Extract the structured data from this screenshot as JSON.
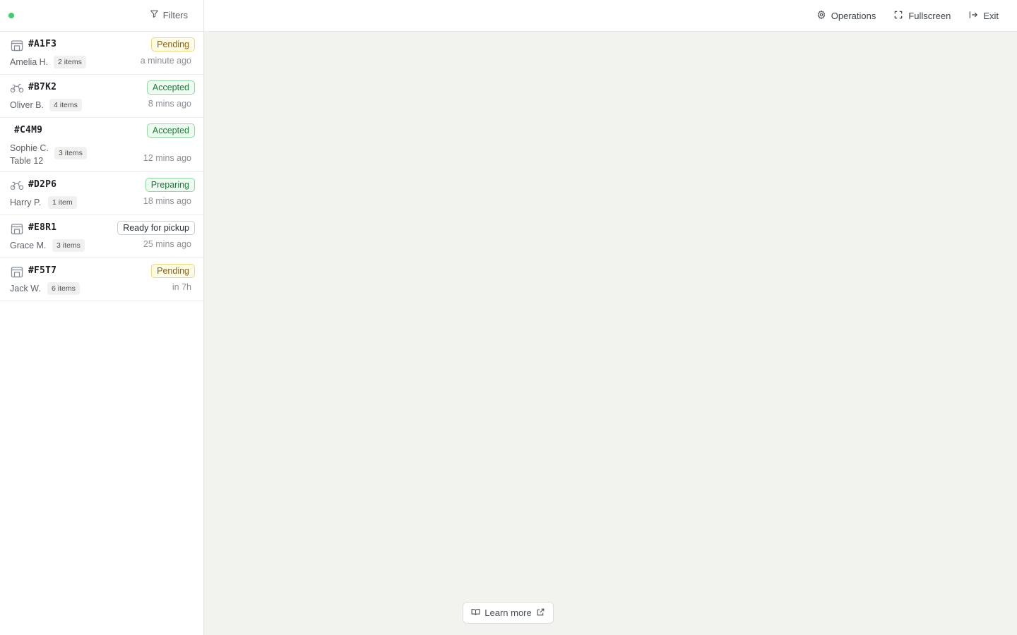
{
  "colors": {
    "live": "#3ecf6a",
    "pending": "#f1d97a",
    "accepted": "#8fd9a0",
    "ready": "#c9ccd1"
  },
  "sidebar": {
    "live_indicator": "live-status-dot",
    "filters_icon": "filter-icon",
    "filters_label": "Filters"
  },
  "orders": [
    {
      "type_icon": "store-icon",
      "code": "#A1F3",
      "status": "Pending",
      "customer": "Amelia H.",
      "items": "2 items",
      "time": "a minute ago"
    },
    {
      "type_icon": "delivery-icon",
      "code": "#B7K2",
      "status": "Accepted",
      "customer": "Oliver B.",
      "items": "4 items",
      "time": "8 mins ago"
    },
    {
      "type_icon": "",
      "code": "#C4M9",
      "status": "Accepted",
      "customer": "Sophie C.",
      "table": "Table 12",
      "items": "3 items",
      "time": "12 mins ago"
    },
    {
      "type_icon": "delivery-icon",
      "code": "#D2P6",
      "status": "Preparing",
      "customer": "Harry P.",
      "items": "1 item",
      "time": "18 mins ago"
    },
    {
      "type_icon": "store-icon",
      "code": "#E8R1",
      "status": "Ready for pickup",
      "customer": "Grace M.",
      "items": "3 items",
      "time": "25 mins ago"
    },
    {
      "type_icon": "store-icon",
      "code": "#F5T7",
      "status": "Pending",
      "customer": "Jack W.",
      "items": "6 items",
      "time": "in 7h"
    }
  ],
  "topbar": {
    "operations_label": "Operations",
    "operations_icon": "gear-icon",
    "fullscreen_label": "Fullscreen",
    "fullscreen_icon": "expand-icon",
    "exit_label": "Exit",
    "exit_icon": "exit-icon"
  },
  "footer": {
    "learn_more_label": "Learn more",
    "learn_more_icon": "book-icon",
    "external_icon": "external-link-icon"
  }
}
